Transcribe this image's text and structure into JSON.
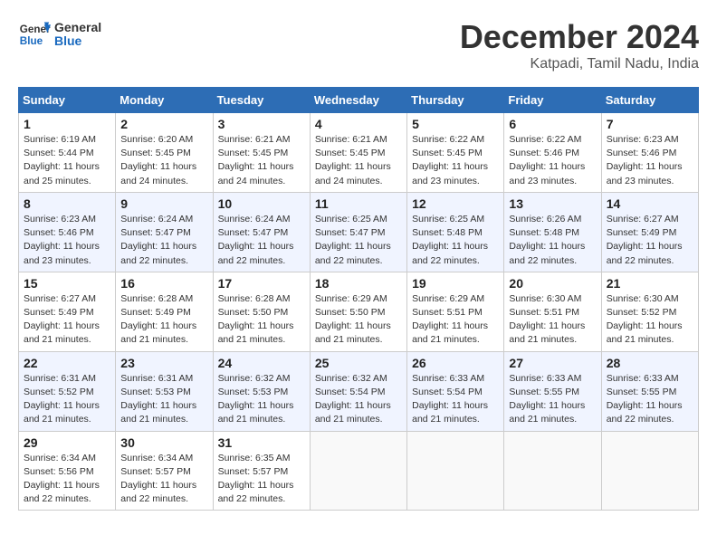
{
  "header": {
    "logo_line1": "General",
    "logo_line2": "Blue",
    "title": "December 2024",
    "subtitle": "Katpadi, Tamil Nadu, India"
  },
  "calendar": {
    "days_of_week": [
      "Sunday",
      "Monday",
      "Tuesday",
      "Wednesday",
      "Thursday",
      "Friday",
      "Saturday"
    ],
    "weeks": [
      [
        {
          "day": "1",
          "info": "Sunrise: 6:19 AM\nSunset: 5:44 PM\nDaylight: 11 hours\nand 25 minutes."
        },
        {
          "day": "2",
          "info": "Sunrise: 6:20 AM\nSunset: 5:45 PM\nDaylight: 11 hours\nand 24 minutes."
        },
        {
          "day": "3",
          "info": "Sunrise: 6:21 AM\nSunset: 5:45 PM\nDaylight: 11 hours\nand 24 minutes."
        },
        {
          "day": "4",
          "info": "Sunrise: 6:21 AM\nSunset: 5:45 PM\nDaylight: 11 hours\nand 24 minutes."
        },
        {
          "day": "5",
          "info": "Sunrise: 6:22 AM\nSunset: 5:45 PM\nDaylight: 11 hours\nand 23 minutes."
        },
        {
          "day": "6",
          "info": "Sunrise: 6:22 AM\nSunset: 5:46 PM\nDaylight: 11 hours\nand 23 minutes."
        },
        {
          "day": "7",
          "info": "Sunrise: 6:23 AM\nSunset: 5:46 PM\nDaylight: 11 hours\nand 23 minutes."
        }
      ],
      [
        {
          "day": "8",
          "info": "Sunrise: 6:23 AM\nSunset: 5:46 PM\nDaylight: 11 hours\nand 23 minutes."
        },
        {
          "day": "9",
          "info": "Sunrise: 6:24 AM\nSunset: 5:47 PM\nDaylight: 11 hours\nand 22 minutes."
        },
        {
          "day": "10",
          "info": "Sunrise: 6:24 AM\nSunset: 5:47 PM\nDaylight: 11 hours\nand 22 minutes."
        },
        {
          "day": "11",
          "info": "Sunrise: 6:25 AM\nSunset: 5:47 PM\nDaylight: 11 hours\nand 22 minutes."
        },
        {
          "day": "12",
          "info": "Sunrise: 6:25 AM\nSunset: 5:48 PM\nDaylight: 11 hours\nand 22 minutes."
        },
        {
          "day": "13",
          "info": "Sunrise: 6:26 AM\nSunset: 5:48 PM\nDaylight: 11 hours\nand 22 minutes."
        },
        {
          "day": "14",
          "info": "Sunrise: 6:27 AM\nSunset: 5:49 PM\nDaylight: 11 hours\nand 22 minutes."
        }
      ],
      [
        {
          "day": "15",
          "info": "Sunrise: 6:27 AM\nSunset: 5:49 PM\nDaylight: 11 hours\nand 21 minutes."
        },
        {
          "day": "16",
          "info": "Sunrise: 6:28 AM\nSunset: 5:49 PM\nDaylight: 11 hours\nand 21 minutes."
        },
        {
          "day": "17",
          "info": "Sunrise: 6:28 AM\nSunset: 5:50 PM\nDaylight: 11 hours\nand 21 minutes."
        },
        {
          "day": "18",
          "info": "Sunrise: 6:29 AM\nSunset: 5:50 PM\nDaylight: 11 hours\nand 21 minutes."
        },
        {
          "day": "19",
          "info": "Sunrise: 6:29 AM\nSunset: 5:51 PM\nDaylight: 11 hours\nand 21 minutes."
        },
        {
          "day": "20",
          "info": "Sunrise: 6:30 AM\nSunset: 5:51 PM\nDaylight: 11 hours\nand 21 minutes."
        },
        {
          "day": "21",
          "info": "Sunrise: 6:30 AM\nSunset: 5:52 PM\nDaylight: 11 hours\nand 21 minutes."
        }
      ],
      [
        {
          "day": "22",
          "info": "Sunrise: 6:31 AM\nSunset: 5:52 PM\nDaylight: 11 hours\nand 21 minutes."
        },
        {
          "day": "23",
          "info": "Sunrise: 6:31 AM\nSunset: 5:53 PM\nDaylight: 11 hours\nand 21 minutes."
        },
        {
          "day": "24",
          "info": "Sunrise: 6:32 AM\nSunset: 5:53 PM\nDaylight: 11 hours\nand 21 minutes."
        },
        {
          "day": "25",
          "info": "Sunrise: 6:32 AM\nSunset: 5:54 PM\nDaylight: 11 hours\nand 21 minutes."
        },
        {
          "day": "26",
          "info": "Sunrise: 6:33 AM\nSunset: 5:54 PM\nDaylight: 11 hours\nand 21 minutes."
        },
        {
          "day": "27",
          "info": "Sunrise: 6:33 AM\nSunset: 5:55 PM\nDaylight: 11 hours\nand 21 minutes."
        },
        {
          "day": "28",
          "info": "Sunrise: 6:33 AM\nSunset: 5:55 PM\nDaylight: 11 hours\nand 22 minutes."
        }
      ],
      [
        {
          "day": "29",
          "info": "Sunrise: 6:34 AM\nSunset: 5:56 PM\nDaylight: 11 hours\nand 22 minutes."
        },
        {
          "day": "30",
          "info": "Sunrise: 6:34 AM\nSunset: 5:57 PM\nDaylight: 11 hours\nand 22 minutes."
        },
        {
          "day": "31",
          "info": "Sunrise: 6:35 AM\nSunset: 5:57 PM\nDaylight: 11 hours\nand 22 minutes."
        },
        {
          "day": "",
          "info": ""
        },
        {
          "day": "",
          "info": ""
        },
        {
          "day": "",
          "info": ""
        },
        {
          "day": "",
          "info": ""
        }
      ]
    ]
  }
}
